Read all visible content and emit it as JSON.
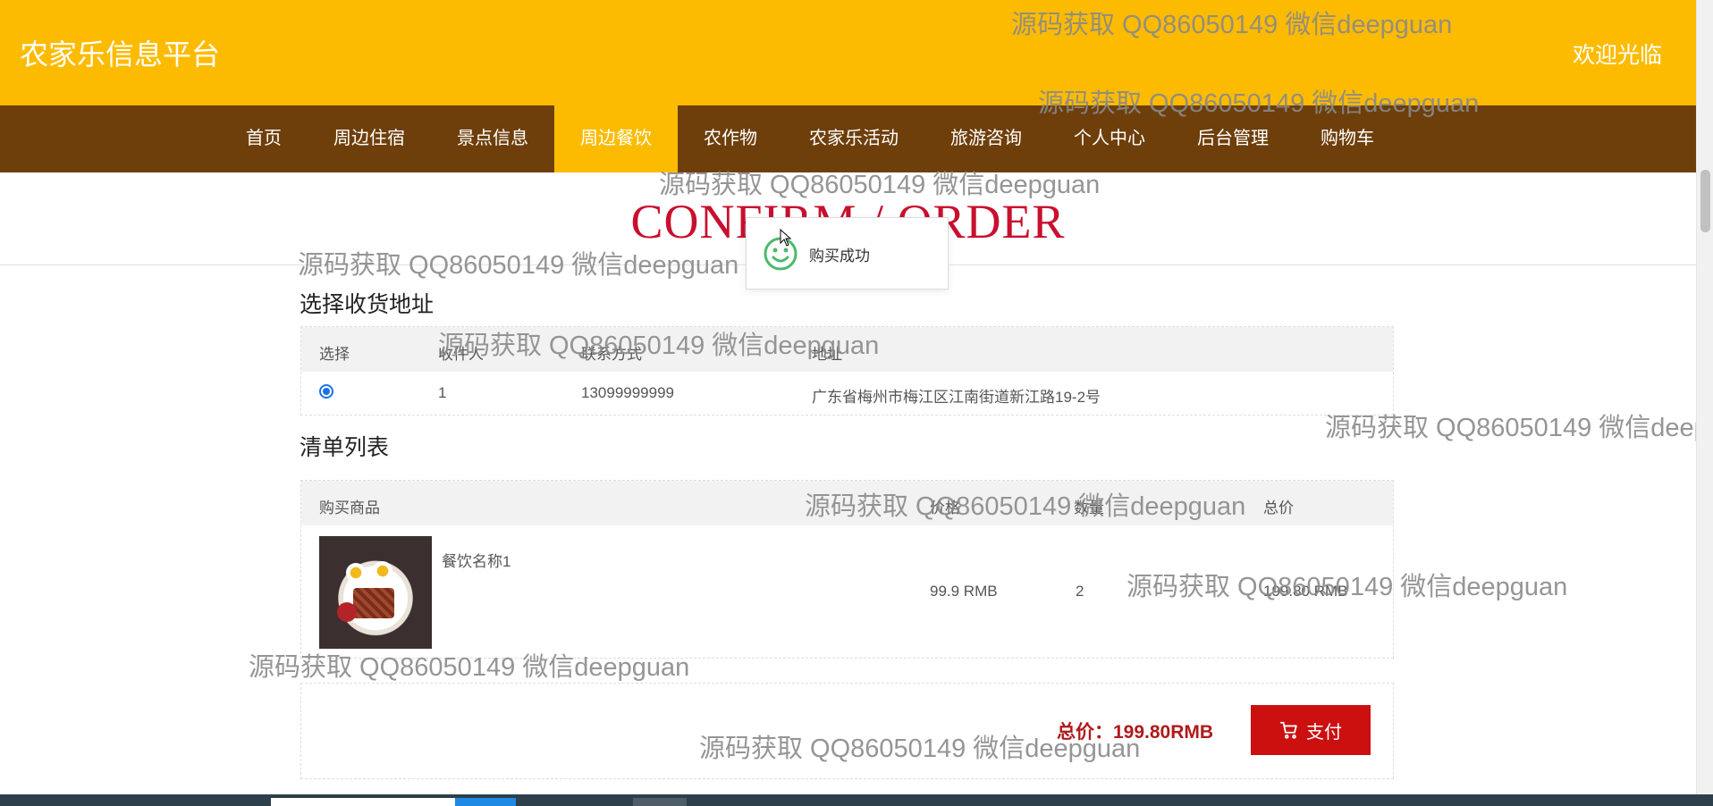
{
  "header": {
    "site_title": "农家乐信息平台",
    "welcome": "欢迎光临"
  },
  "nav": {
    "items": [
      "首页",
      "周边住宿",
      "景点信息",
      "周边餐饮",
      "农作物",
      "农家乐活动",
      "旅游咨询",
      "个人中心",
      "后台管理",
      "购物车"
    ],
    "active": "周边餐饮"
  },
  "page_title": "CONFIRM / ORDER",
  "toast": {
    "message": "购买成功"
  },
  "address": {
    "section_title": "选择收货地址",
    "headers": {
      "select": "选择",
      "recipient": "收件人",
      "contact": "联系方式",
      "address": "地址"
    },
    "rows": [
      {
        "selected": true,
        "recipient": "1",
        "contact": "13099999999",
        "address": "广东省梅州市梅江区江南街道新江路19-2号"
      }
    ]
  },
  "order": {
    "section_title": "清单列表",
    "headers": {
      "product": "购买商品",
      "price": "价格",
      "quantity": "数量",
      "subtotal": "总价"
    },
    "items": [
      {
        "name": "餐饮名称1",
        "price": "99.9 RMB",
        "quantity": "2",
        "subtotal": "199.80 RMB"
      }
    ]
  },
  "total": {
    "label": "总价：199.80RMB"
  },
  "pay_button": {
    "label": "支付"
  },
  "watermark_text": "源码获取 QQ86050149 微信deepguan",
  "colors": {
    "header_bg": "#fdbb00",
    "nav_bg": "#6e3f0b",
    "title_red": "#c8102e",
    "pay_red": "#cc1010"
  }
}
